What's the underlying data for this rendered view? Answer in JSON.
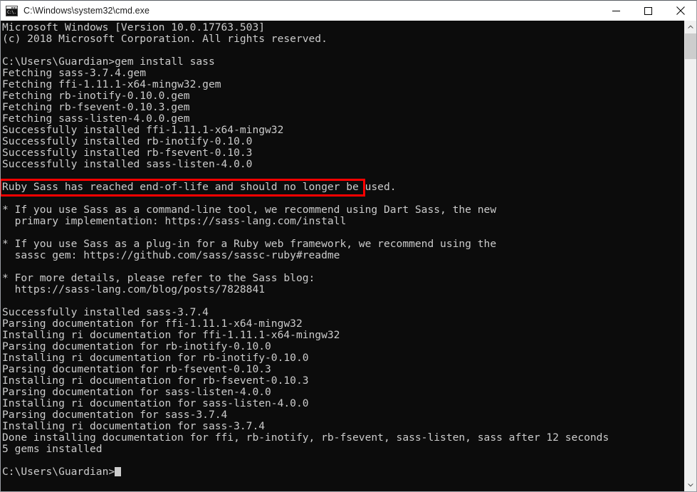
{
  "window": {
    "title": "C:\\Windows\\system32\\cmd.exe",
    "icon": "cmd-console-icon",
    "icon_text": "C:\\.",
    "background_color": "#0c0c0c",
    "text_color": "#cccccc",
    "titlebar_color": "#ffffff"
  },
  "controls": {
    "minimize": "minimize-button",
    "maximize": "maximize-button",
    "close": "close-button"
  },
  "terminal": {
    "lines": [
      "Microsoft Windows [Version 10.0.17763.503]",
      "(c) 2018 Microsoft Corporation. All rights reserved.",
      "",
      "C:\\Users\\Guardian>gem install sass",
      "Fetching sass-3.7.4.gem",
      "Fetching ffi-1.11.1-x64-mingw32.gem",
      "Fetching rb-inotify-0.10.0.gem",
      "Fetching rb-fsevent-0.10.3.gem",
      "Fetching sass-listen-4.0.0.gem",
      "Successfully installed ffi-1.11.1-x64-mingw32",
      "Successfully installed rb-inotify-0.10.0",
      "Successfully installed rb-fsevent-0.10.3",
      "Successfully installed sass-listen-4.0.0",
      "",
      "Ruby Sass has reached end-of-life and should no longer be used.",
      "",
      "* If you use Sass as a command-line tool, we recommend using Dart Sass, the new",
      "  primary implementation: https://sass-lang.com/install",
      "",
      "* If you use Sass as a plug-in for a Ruby web framework, we recommend using the",
      "  sassc gem: https://github.com/sass/sassc-ruby#readme",
      "",
      "* For more details, please refer to the Sass blog:",
      "  https://sass-lang.com/blog/posts/7828841",
      "",
      "Successfully installed sass-3.7.4",
      "Parsing documentation for ffi-1.11.1-x64-mingw32",
      "Installing ri documentation for ffi-1.11.1-x64-mingw32",
      "Parsing documentation for rb-inotify-0.10.0",
      "Installing ri documentation for rb-inotify-0.10.0",
      "Parsing documentation for rb-fsevent-0.10.3",
      "Installing ri documentation for rb-fsevent-0.10.3",
      "Parsing documentation for sass-listen-4.0.0",
      "Installing ri documentation for sass-listen-4.0.0",
      "Parsing documentation for sass-3.7.4",
      "Installing ri documentation for sass-3.7.4",
      "Done installing documentation for ffi, rb-inotify, rb-fsevent, sass-listen, sass after 12 seconds",
      "5 gems installed",
      ""
    ],
    "prompt": "C:\\Users\\Guardian>",
    "cursor": "block-cursor"
  },
  "annotation": {
    "type": "highlight-rectangle",
    "color": "#ff0000",
    "target_line": "Ruby Sass has reached end-of-life and should no longer be used."
  },
  "scrollbar": {
    "up_arrow": "scroll-up-arrow",
    "down_arrow": "scroll-down-arrow",
    "thumb": "scrollbar-thumb"
  }
}
